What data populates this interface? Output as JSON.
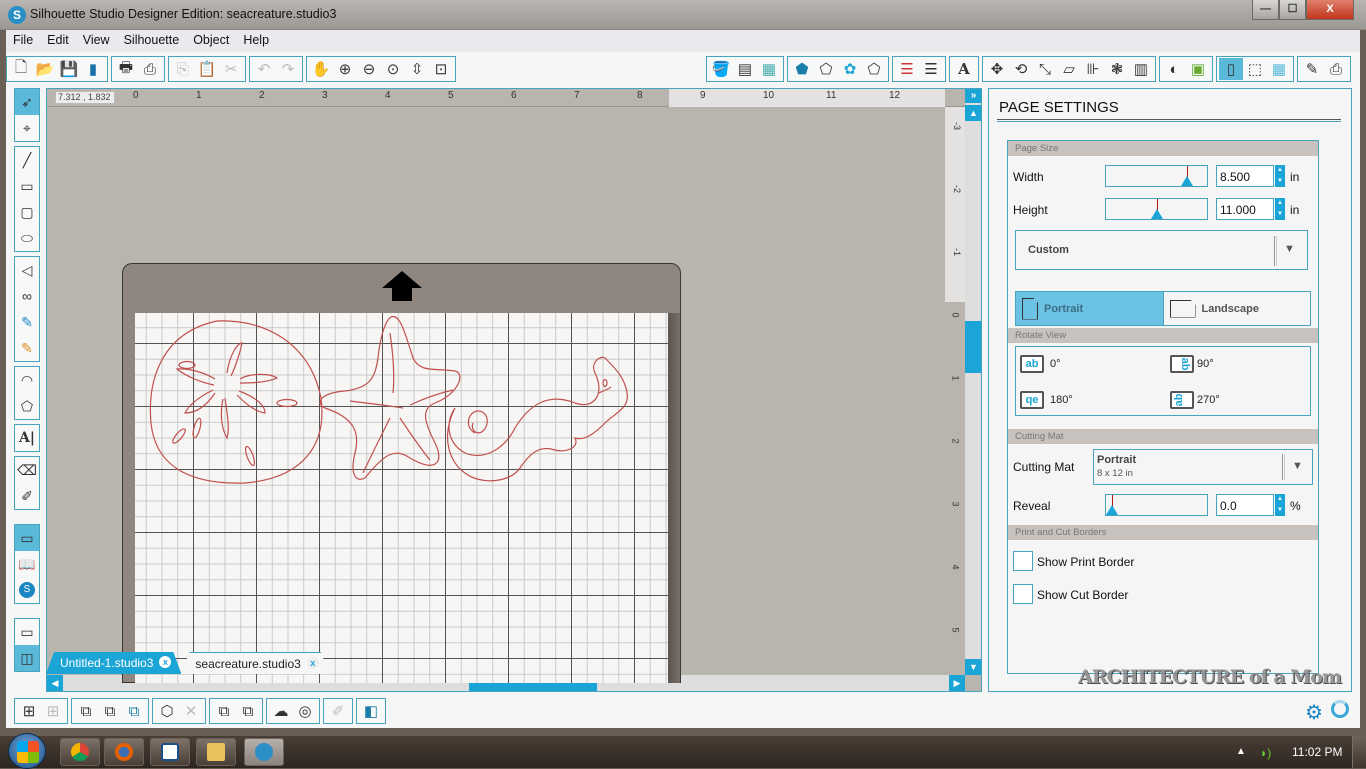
{
  "window": {
    "title": "Silhouette Studio Designer Edition: seacreature.studio3",
    "app_icon": "silhouette-s-icon",
    "controls": {
      "minimize": "—",
      "maximize": "☐",
      "close": "X"
    }
  },
  "menu": [
    "File",
    "Edit",
    "View",
    "Silhouette",
    "Object",
    "Help"
  ],
  "toolbar_left": [
    {
      "group": "file",
      "items": [
        "new-document-icon",
        "open-folder-icon",
        "save-icon",
        "save-to-sd-icon"
      ]
    },
    {
      "group": "print",
      "items": [
        "print-icon",
        "send-to-silhouette-icon"
      ]
    },
    {
      "group": "clipboard",
      "items": [
        "copy-icon",
        "paste-icon",
        "cut-icon"
      ]
    },
    {
      "group": "history",
      "items": [
        "undo-icon",
        "redo-icon"
      ]
    },
    {
      "group": "view",
      "items": [
        "pan-hand-icon",
        "zoom-in-icon",
        "zoom-out-icon",
        "zoom-select-icon",
        "zoom-fit-icon",
        "fit-to-page-icon"
      ]
    }
  ],
  "toolbar_right": [
    {
      "group": "fill",
      "items": [
        "fill-color-icon",
        "gradient-fill-icon",
        "pattern-fill-icon"
      ]
    },
    {
      "group": "line",
      "items": [
        "line-color-icon",
        "line-style-icon",
        "sketch-icon",
        "point-edit-icon"
      ]
    },
    {
      "group": "stroke",
      "items": [
        "line-weight-icon",
        "line-dash-icon"
      ]
    },
    {
      "group": "text",
      "items": [
        "text-style-icon"
      ]
    },
    {
      "group": "transform",
      "items": [
        "transform-icon",
        "rotate-icon",
        "scale-icon",
        "shear-icon",
        "align-icon",
        "replicate-icon",
        "modify-icon"
      ]
    },
    {
      "group": "library",
      "items": [
        "store-icon",
        "trace-icon"
      ]
    },
    {
      "group": "page",
      "items": [
        "page-settings-icon",
        "cut-settings-icon",
        "grid-settings-icon"
      ]
    },
    {
      "group": "send",
      "items": [
        "eraser-panel-icon",
        "send-panel-icon"
      ]
    }
  ],
  "left_tools": [
    {
      "group": "select",
      "items": [
        {
          "icon": "select-arrow-icon",
          "active": true
        },
        {
          "icon": "point-edit-tool-icon",
          "active": false
        }
      ]
    },
    {
      "group": "shapes",
      "items": [
        {
          "icon": "line-tool-icon"
        },
        {
          "icon": "rectangle-tool-icon"
        },
        {
          "icon": "rounded-rectangle-tool-icon"
        },
        {
          "icon": "ellipse-tool-icon"
        }
      ]
    },
    {
      "group": "draw",
      "items": [
        {
          "icon": "polygon-tool-icon"
        },
        {
          "icon": "curve-tool-icon"
        },
        {
          "icon": "freehand-tool-icon"
        },
        {
          "icon": "smooth-freehand-tool-icon"
        }
      ]
    },
    {
      "group": "arc",
      "items": [
        {
          "icon": "arc-tool-icon"
        },
        {
          "icon": "regular-polygon-tool-icon"
        }
      ]
    },
    {
      "group": "text",
      "items": [
        {
          "icon": "text-tool-icon"
        }
      ]
    },
    {
      "group": "erase",
      "items": [
        {
          "icon": "eraser-tool-icon"
        },
        {
          "icon": "knife-tool-icon"
        }
      ]
    },
    {
      "group": "panels",
      "items": [
        {
          "icon": "design-page-icon",
          "active": true
        },
        {
          "icon": "library-icon"
        },
        {
          "icon": "silhouette-store-icon"
        }
      ]
    },
    {
      "group": "layout",
      "items": [
        {
          "icon": "single-view-icon"
        },
        {
          "icon": "split-view-icon",
          "active": true
        }
      ]
    }
  ],
  "canvas": {
    "coordinates": "7.312 , 1.832",
    "h_ruler_labels": [
      "0",
      "1",
      "2",
      "3",
      "4",
      "5",
      "6",
      "7",
      "8",
      "9",
      "10",
      "11",
      "12"
    ],
    "v_ruler_labels": [
      "-3",
      "-2",
      "-1",
      "0",
      "1",
      "2",
      "3",
      "4",
      "5"
    ],
    "feed_direction": "up-arrow-icon",
    "mat_shapes": [
      "sand-dollar",
      "starfish",
      "seahorse-spiral"
    ],
    "colors": {
      "cut_line": "#c0504d",
      "mat": "#8f877f",
      "accent": "#1ba5d6"
    }
  },
  "tabs": [
    {
      "label": "Untitled-1.studio3",
      "active": false,
      "close": "x"
    },
    {
      "label": "seacreature.studio3",
      "active": true,
      "close": "x"
    }
  ],
  "bottom_toolbar": [
    {
      "group": "group",
      "items": [
        "group-icon",
        "ungroup-icon"
      ]
    },
    {
      "group": "compound",
      "items": [
        "make-compound-path-icon",
        "release-compound-path-icon",
        "weld-icon"
      ]
    },
    {
      "group": "duplicate",
      "items": [
        "duplicate-icon",
        "delete-icon"
      ]
    },
    {
      "group": "order",
      "items": [
        "bring-to-front-icon",
        "send-to-back-icon"
      ]
    },
    {
      "group": "shape",
      "items": [
        "weld-shape-icon",
        "offset-icon"
      ]
    },
    {
      "group": "trace",
      "items": [
        "trace-tool-icon"
      ]
    },
    {
      "group": "layers",
      "items": [
        "layers-icon"
      ]
    }
  ],
  "panel": {
    "title": "PAGE SETTINGS",
    "page_size": {
      "section": "Page Size",
      "width_label": "Width",
      "width_value": "8.500",
      "width_slider_fraction": 0.84,
      "height_label": "Height",
      "height_value": "11.000",
      "height_slider_fraction": 0.5,
      "unit": "in",
      "preset": "Custom",
      "orientation": [
        {
          "label": "Portrait",
          "selected": true
        },
        {
          "label": "Landscape",
          "selected": false
        }
      ]
    },
    "rotate_view": {
      "section": "Rotate View",
      "options": [
        {
          "icon_text": "ab",
          "label": "0°"
        },
        {
          "icon_text": "ab",
          "label": "90°"
        },
        {
          "icon_text": "qe",
          "label": "180°"
        },
        {
          "icon_text": "ab",
          "label": "270°"
        }
      ]
    },
    "cutting_mat": {
      "section": "Cutting Mat",
      "label": "Cutting Mat",
      "value": "Portrait",
      "sub": "8 x 12 in",
      "reveal_label": "Reveal",
      "reveal_value": "0.0",
      "reveal_fraction": 0.0,
      "reveal_unit": "%"
    },
    "borders": {
      "section": "Print and Cut Borders",
      "options": [
        {
          "label": "Show Print Border",
          "checked": false
        },
        {
          "label": "Show Cut Border",
          "checked": false
        }
      ]
    }
  },
  "watermark": "ARCHITECTURE of a Mom",
  "taskbar": {
    "apps": [
      "chrome",
      "firefox",
      "inkscape",
      "file-explorer",
      "silhouette-studio"
    ],
    "clock": "11:02 PM",
    "tray_up": "▲"
  }
}
